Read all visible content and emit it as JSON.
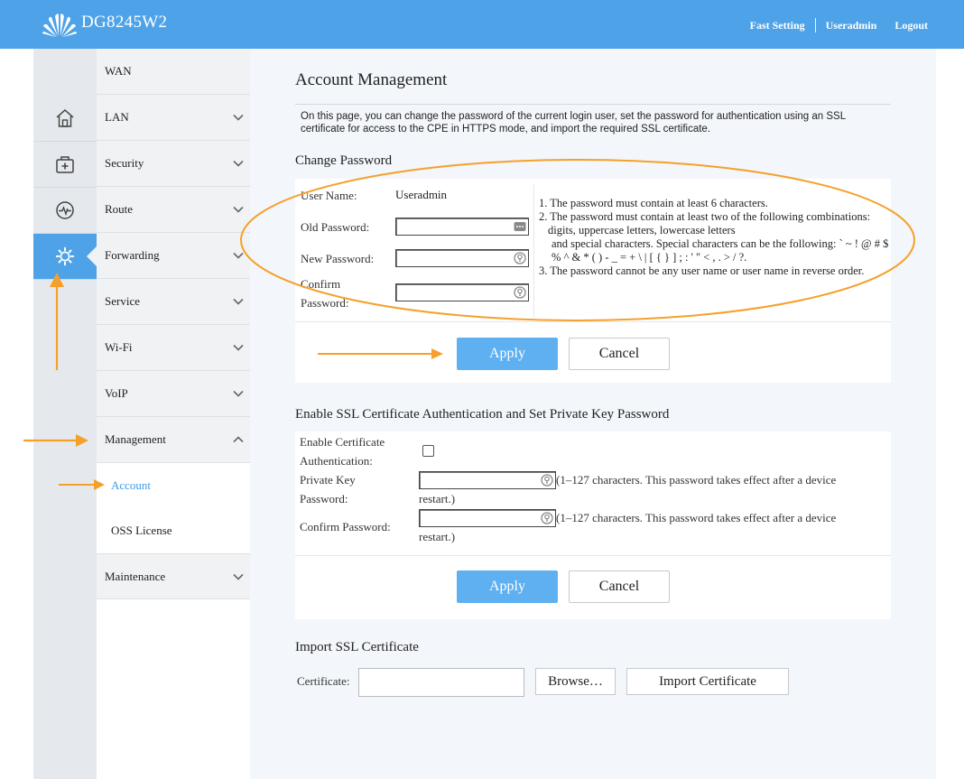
{
  "header": {
    "brand": "DG8245W2",
    "nav": {
      "fast_setting": "Fast Setting",
      "user": "Useradmin",
      "logout": "Logout"
    }
  },
  "rail": {
    "icons": [
      "home-icon",
      "toolbox-icon",
      "pulse-icon",
      "gear-icon"
    ],
    "active_index": 3
  },
  "menu": {
    "items": {
      "wan": "WAN",
      "lan": "LAN",
      "security": "Security",
      "route": "Route",
      "forwarding": "Forwarding",
      "service": "Service",
      "wifi": "Wi-Fi",
      "voip": "VoIP",
      "management": "Management",
      "maintenance": "Maintenance"
    },
    "sub": {
      "account": "Account",
      "oss_license": "OSS License"
    }
  },
  "main": {
    "title": "Account Management",
    "intro": "On this page, you can change the password of the current login user, set the password for authentication using an SSL certificate for access to the CPE in HTTPS mode, and import the required SSL certificate.",
    "change_password": {
      "title": "Change Password",
      "user_name_label": "User Name:",
      "user_name_value": "Useradmin",
      "old_password_label": "Old Password:",
      "new_password_label": "New Password:",
      "confirm_label_1": "Confirm",
      "confirm_label_2": "Password:",
      "rules": {
        "r1": "1. The password must contain at least 6 characters.",
        "r2": "2. The password must contain at least two of the following combinations:",
        "r2a": "digits, uppercase letters, lowercase letters",
        "r2b": "and special characters. Special characters can be the following: ` ~ ! @ # $ % ^ & * ( ) - _ = + \\ | [ { } ] ; : ' \" < , . > / ?.",
        "r3": "3. The password cannot be any user name or user name in reverse order."
      },
      "apply": "Apply",
      "cancel": "Cancel"
    },
    "ssl": {
      "title": "Enable SSL Certificate Authentication and Set Private Key Password",
      "enable_label_1": "Enable Certificate",
      "enable_label_2": "Authentication:",
      "pk_label_1": "Private Key",
      "pk_label_2": "Password:",
      "confirm_label": "Confirm Password:",
      "hint_1": "(1–127 characters. This password takes effect after a device",
      "hint_2": "restart.)",
      "apply": "Apply",
      "cancel": "Cancel"
    },
    "import": {
      "title": "Import SSL Certificate",
      "cert_label": "Certificate:",
      "browse": "Browse…",
      "import_btn": "Import Certificate"
    }
  },
  "colors": {
    "header": "#4ea3e8",
    "primary_button": "#5eb0f0",
    "annotation": "#f5a02a",
    "active_link": "#3c9ee6"
  }
}
